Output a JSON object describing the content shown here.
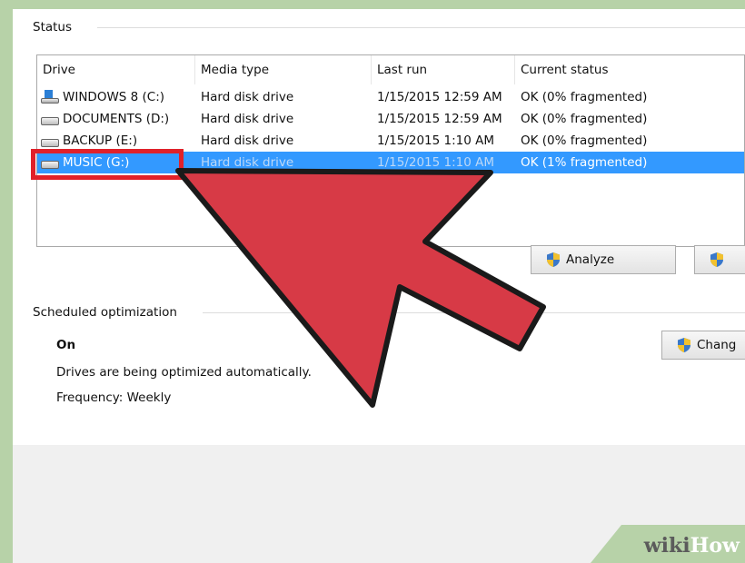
{
  "status": {
    "title": "Status",
    "columns": [
      "Drive",
      "Media type",
      "Last run",
      "Current status"
    ],
    "rows": [
      {
        "drive": "WINDOWS 8 (C:)",
        "media": "Hard disk drive",
        "last_run": "1/15/2015 12:59 AM",
        "status": "OK (0% fragmented)",
        "icon": "system-drive-icon"
      },
      {
        "drive": "DOCUMENTS (D:)",
        "media": "Hard disk drive",
        "last_run": "1/15/2015 12:59 AM",
        "status": "OK (0% fragmented)",
        "icon": "hard-drive-icon"
      },
      {
        "drive": "BACKUP (E:)",
        "media": "Hard disk drive",
        "last_run": "1/15/2015 1:10 AM",
        "status": "OK (0% fragmented)",
        "icon": "hard-drive-icon"
      },
      {
        "drive": "MUSIC (G:)",
        "media": "Hard disk drive",
        "last_run": "1/15/2015 1:10 AM",
        "status": "OK (1% fragmented)",
        "icon": "hard-drive-icon",
        "selected": true
      }
    ],
    "analyze_label": "Analyze"
  },
  "scheduled": {
    "title": "Scheduled optimization",
    "state": "On",
    "description": "Drives are being optimized automatically.",
    "frequency": "Frequency: Weekly",
    "change_label": "Chang"
  },
  "watermark": {
    "wiki": "wiki",
    "how": "How"
  },
  "colors": {
    "selection": "#3399ff",
    "highlight": "#e0212a",
    "arrow": "#d73a46"
  }
}
